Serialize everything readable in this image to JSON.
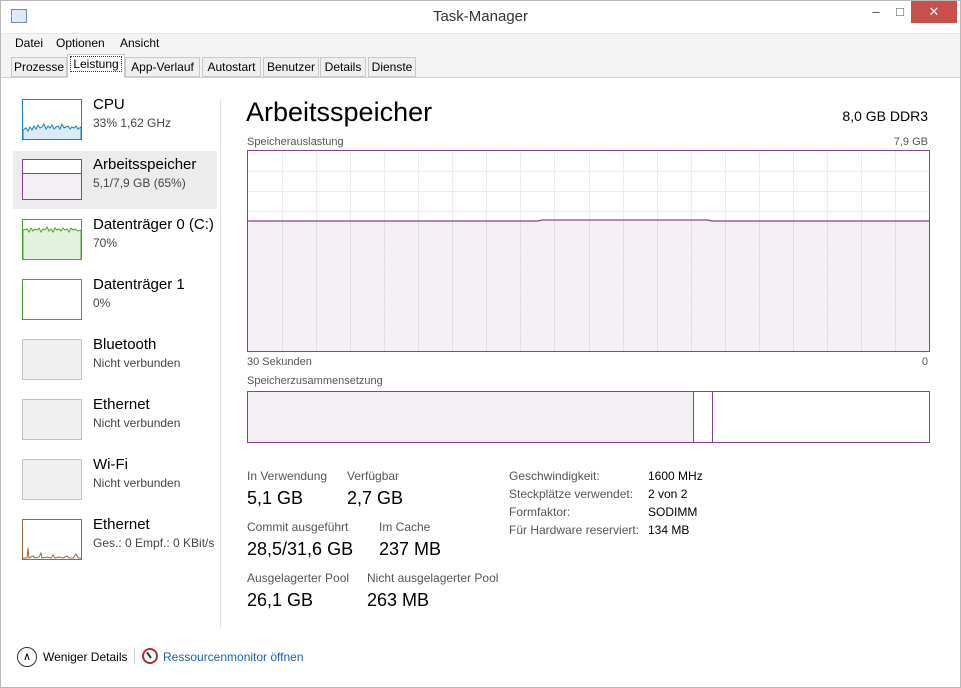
{
  "window": {
    "title": "Task-Manager",
    "min": "–",
    "max": "□",
    "close": "✕"
  },
  "menu": [
    "Datei",
    "Optionen",
    "Ansicht"
  ],
  "tabs": [
    {
      "label": "Prozesse",
      "active": false
    },
    {
      "label": "Leistung",
      "active": true
    },
    {
      "label": "App-Verlauf",
      "active": false
    },
    {
      "label": "Autostart",
      "active": false
    },
    {
      "label": "Benutzer",
      "active": false
    },
    {
      "label": "Details",
      "active": false
    },
    {
      "label": "Dienste",
      "active": false
    }
  ],
  "sidebar": {
    "items": [
      {
        "name": "CPU",
        "sub": "33%  1,62 GHz",
        "color": "#1a80c4",
        "selected": false
      },
      {
        "name": "Arbeitsspeicher",
        "sub": "5,1/7,9 GB (65%)",
        "color": "#8b3f9b",
        "selected": true
      },
      {
        "name": "Datenträger 0 (C:)",
        "sub": "70%",
        "color": "#4da033",
        "selected": false
      },
      {
        "name": "Datenträger 1",
        "sub": "0%",
        "color": "#4da033",
        "selected": false
      },
      {
        "name": "Bluetooth",
        "sub": "Nicht verbunden",
        "color": "#c2c2c2",
        "selected": false
      },
      {
        "name": "Ethernet",
        "sub": "Nicht verbunden",
        "color": "#c2c2c2",
        "selected": false
      },
      {
        "name": "Wi-Fi",
        "sub": "Nicht verbunden",
        "color": "#c2c2c2",
        "selected": false
      },
      {
        "name": "Ethernet",
        "sub": "Ges.: 0  Empf.: 0 KBit/s",
        "color": "#a7643a",
        "selected": false
      }
    ]
  },
  "main": {
    "title": "Arbeitsspeicher",
    "spec": "8,0 GB DDR3",
    "usage_label": "Speicherauslastung",
    "usage_max": "7,9 GB",
    "time_left": "30 Sekunden",
    "time_right": "0",
    "composition_label": "Speicherzusammensetzung",
    "usage_fraction": 0.65,
    "accent": "#8b3f9b",
    "stats": {
      "in_use_label": "In Verwendung",
      "in_use_value": "5,1 GB",
      "available_label": "Verfügbar",
      "available_value": "2,7 GB",
      "commit_label": "Commit ausgeführt",
      "commit_value": "28,5/31,6 GB",
      "cache_label": "Im Cache",
      "cache_value": "237 MB",
      "paged_label": "Ausgelagerter Pool",
      "paged_value": "26,1 GB",
      "nonpaged_label": "Nicht ausgelagerter Pool",
      "nonpaged_value": "263 MB"
    },
    "specs": [
      {
        "key": "Geschwindigkeit:",
        "value": "1600 MHz"
      },
      {
        "key": "Steckplätze verwendet:",
        "value": "2 von 2"
      },
      {
        "key": "Formfaktor:",
        "value": "SODIMM"
      },
      {
        "key": "Für Hardware reserviert:",
        "value": "134 MB"
      }
    ]
  },
  "footer": {
    "less_details": "Weniger Details",
    "less_icon": "∧",
    "resmon": "Ressourcenmonitor öffnen"
  }
}
